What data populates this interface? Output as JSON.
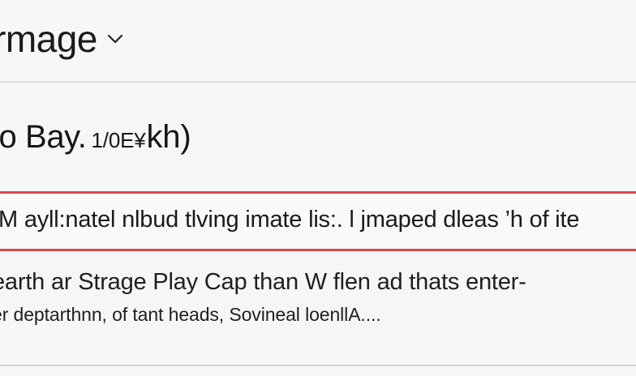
{
  "header": {
    "title": "rmage"
  },
  "headline": {
    "main": "lo Bay.",
    "meta": "1/0E¥",
    "tail": "kh)"
  },
  "highlight": {
    "text": "M ayll:natel nlbud tlving imate lis:. l jmaped dleas ’h of ite"
  },
  "body": {
    "line1": "earth ar Strage Play Cap than W flen ad thats enter-",
    "line2": "er deptarthnn, of tant heads, Sovineal loenllA...."
  },
  "colors": {
    "background": "#f6f6f6",
    "divider": "#d9d9d9",
    "highlight": "#d94a4a",
    "text": "#1f1f1f"
  },
  "icons": {
    "header_dropdown": "chevron-down-icon"
  }
}
